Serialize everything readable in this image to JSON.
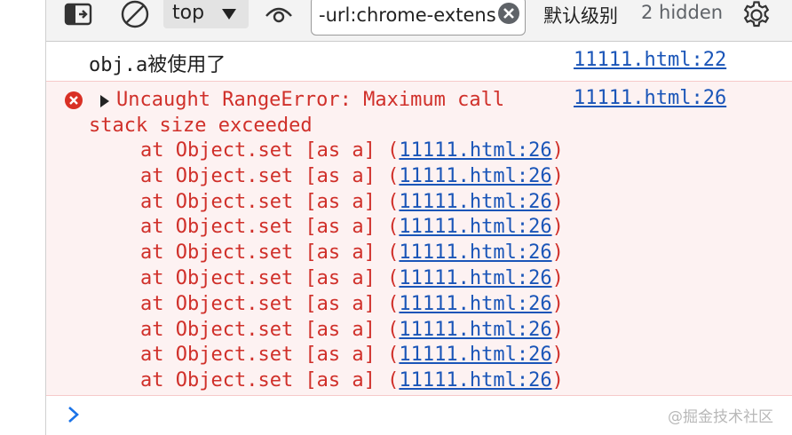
{
  "toolbar": {
    "context": "top",
    "filter_value": "-url:chrome-extens",
    "levels_label": "默认级别",
    "hidden_label": "2 hidden",
    "icons": {
      "sidebar": "sidebar-toggle-icon",
      "clear": "clear-console-icon",
      "caret": "caret-down-icon",
      "live": "eye-icon",
      "clear_filter": "clear-circle-icon",
      "settings": "gear-icon"
    }
  },
  "messages": {
    "info": {
      "text": "obj.a被使用了",
      "source": "11111.html:22"
    },
    "error": {
      "text": "Uncaught RangeError: Maximum call stack size exceeded",
      "source": "11111.html:26",
      "frames": [
        {
          "prefix": "at Object.set [as a] (",
          "link": "11111.html:26",
          "suffix": ")"
        },
        {
          "prefix": "at Object.set [as a] (",
          "link": "11111.html:26",
          "suffix": ")"
        },
        {
          "prefix": "at Object.set [as a] (",
          "link": "11111.html:26",
          "suffix": ")"
        },
        {
          "prefix": "at Object.set [as a] (",
          "link": "11111.html:26",
          "suffix": ")"
        },
        {
          "prefix": "at Object.set [as a] (",
          "link": "11111.html:26",
          "suffix": ")"
        },
        {
          "prefix": "at Object.set [as a] (",
          "link": "11111.html:26",
          "suffix": ")"
        },
        {
          "prefix": "at Object.set [as a] (",
          "link": "11111.html:26",
          "suffix": ")"
        },
        {
          "prefix": "at Object.set [as a] (",
          "link": "11111.html:26",
          "suffix": ")"
        },
        {
          "prefix": "at Object.set [as a] (",
          "link": "11111.html:26",
          "suffix": ")"
        },
        {
          "prefix": "at Object.set [as a] (",
          "link": "11111.html:26",
          "suffix": ")"
        }
      ]
    }
  },
  "watermark": "@掘金技术社区",
  "colors": {
    "error_text": "#d0302a",
    "error_bg": "#fdf2f2",
    "link": "#1a55b8",
    "prompt": "#1a73e8"
  }
}
